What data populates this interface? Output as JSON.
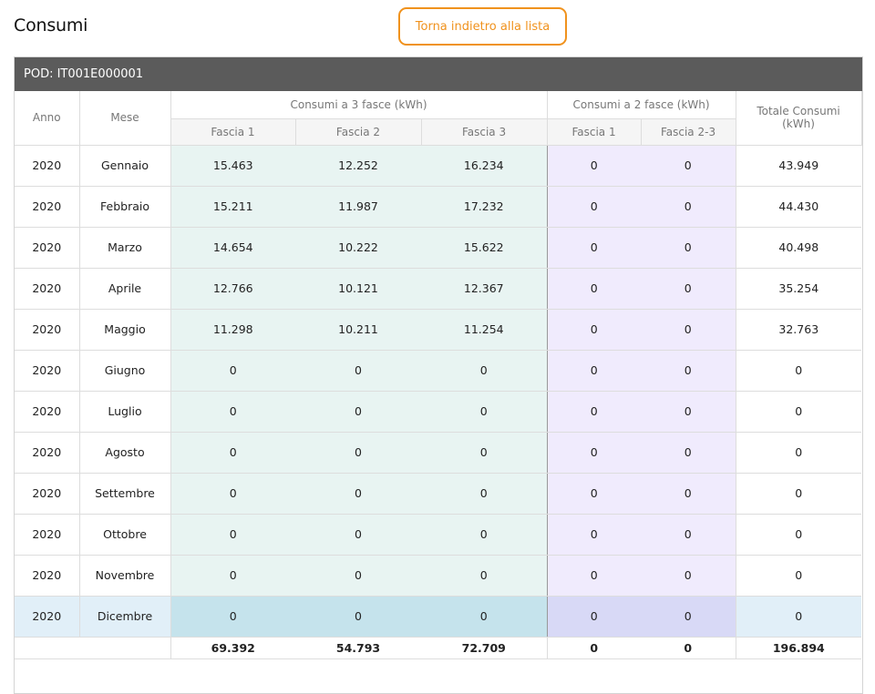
{
  "page": {
    "title": "Consumi",
    "back_label": "Torna indietro alla lista"
  },
  "panel": {
    "pod_label": "POD: IT001E000001"
  },
  "table": {
    "headers": {
      "year": "Anno",
      "month": "Mese",
      "group_3": "Consumi a 3 fasce (kWh)",
      "group_2": "Consumi a 2 fasce (kWh)",
      "total": "Totale Consumi (kWh)",
      "f3_1": "Fascia 1",
      "f3_2": "Fascia 2",
      "f3_3": "Fascia 3",
      "f2_1": "Fascia 1",
      "f2_23": "Fascia 2-3"
    },
    "rows": [
      {
        "year": "2020",
        "month": "Gennaio",
        "f3_1": "15.463",
        "f3_2": "12.252",
        "f3_3": "16.234",
        "f2_1": "0",
        "f2_23": "0",
        "total": "43.949"
      },
      {
        "year": "2020",
        "month": "Febbraio",
        "f3_1": "15.211",
        "f3_2": "11.987",
        "f3_3": "17.232",
        "f2_1": "0",
        "f2_23": "0",
        "total": "44.430"
      },
      {
        "year": "2020",
        "month": "Marzo",
        "f3_1": "14.654",
        "f3_2": "10.222",
        "f3_3": "15.622",
        "f2_1": "0",
        "f2_23": "0",
        "total": "40.498"
      },
      {
        "year": "2020",
        "month": "Aprile",
        "f3_1": "12.766",
        "f3_2": "10.121",
        "f3_3": "12.367",
        "f2_1": "0",
        "f2_23": "0",
        "total": "35.254"
      },
      {
        "year": "2020",
        "month": "Maggio",
        "f3_1": "11.298",
        "f3_2": "10.211",
        "f3_3": "11.254",
        "f2_1": "0",
        "f2_23": "0",
        "total": "32.763"
      },
      {
        "year": "2020",
        "month": "Giugno",
        "f3_1": "0",
        "f3_2": "0",
        "f3_3": "0",
        "f2_1": "0",
        "f2_23": "0",
        "total": "0"
      },
      {
        "year": "2020",
        "month": "Luglio",
        "f3_1": "0",
        "f3_2": "0",
        "f3_3": "0",
        "f2_1": "0",
        "f2_23": "0",
        "total": "0"
      },
      {
        "year": "2020",
        "month": "Agosto",
        "f3_1": "0",
        "f3_2": "0",
        "f3_3": "0",
        "f2_1": "0",
        "f2_23": "0",
        "total": "0"
      },
      {
        "year": "2020",
        "month": "Settembre",
        "f3_1": "0",
        "f3_2": "0",
        "f3_3": "0",
        "f2_1": "0",
        "f2_23": "0",
        "total": "0"
      },
      {
        "year": "2020",
        "month": "Ottobre",
        "f3_1": "0",
        "f3_2": "0",
        "f3_3": "0",
        "f2_1": "0",
        "f2_23": "0",
        "total": "0"
      },
      {
        "year": "2020",
        "month": "Novembre",
        "f3_1": "0",
        "f3_2": "0",
        "f3_3": "0",
        "f2_1": "0",
        "f2_23": "0",
        "total": "0"
      },
      {
        "year": "2020",
        "month": "Dicembre",
        "f3_1": "0",
        "f3_2": "0",
        "f3_3": "0",
        "f2_1": "0",
        "f2_23": "0",
        "total": "0"
      }
    ],
    "totals": {
      "f3_1": "69.392",
      "f3_2": "54.793",
      "f3_3": "72.709",
      "f2_1": "0",
      "f2_23": "0",
      "total": "196.894"
    }
  },
  "colors": {
    "accent": "#f0921d",
    "header_bar": "#5b5b5b",
    "fasce3_bg": "#e8f4f2",
    "fasce2_bg": "#f0ebfd",
    "highlight_row": "#e1eff8"
  }
}
